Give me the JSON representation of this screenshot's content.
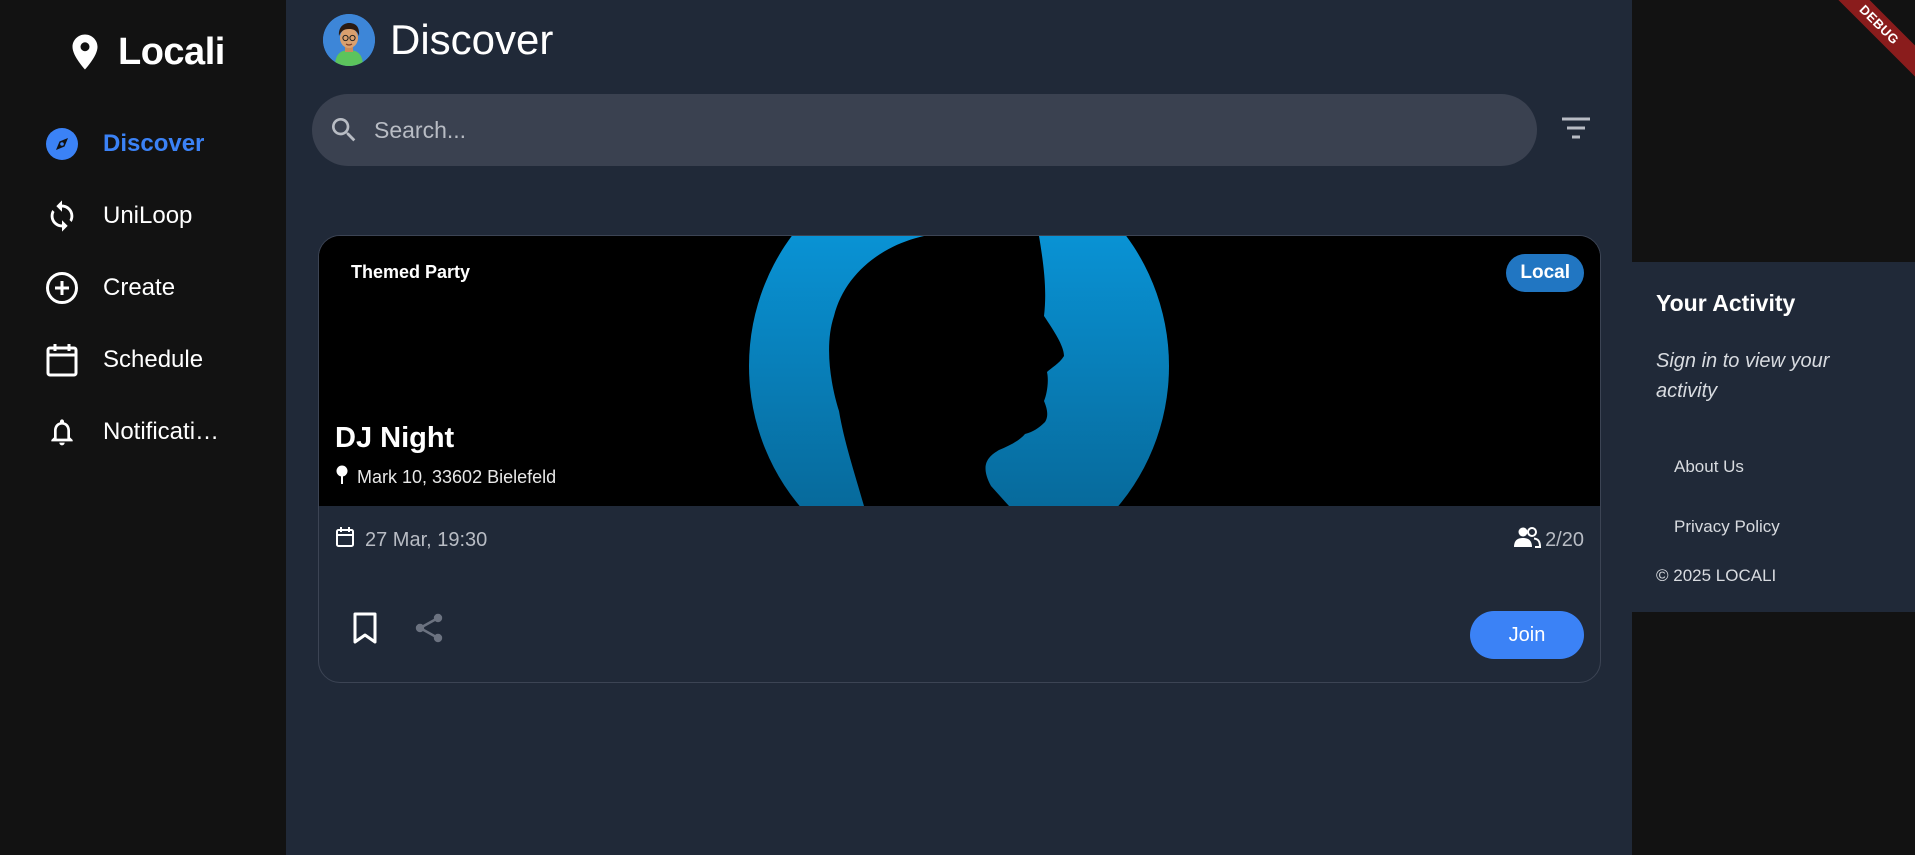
{
  "app": {
    "title": "Locali"
  },
  "sidebar": {
    "items": [
      {
        "label": "Discover",
        "icon": "compass-icon",
        "active": true
      },
      {
        "label": "UniLoop",
        "icon": "sync-icon",
        "active": false
      },
      {
        "label": "Create",
        "icon": "add-circle-icon",
        "active": false
      },
      {
        "label": "Schedule",
        "icon": "calendar-icon",
        "active": false
      },
      {
        "label": "Notifications",
        "display": "Notificati…",
        "icon": "bell-icon",
        "active": false
      }
    ]
  },
  "header": {
    "title": "Discover"
  },
  "search": {
    "placeholder": "Search..."
  },
  "event": {
    "category": "Themed Party",
    "badge": "Local",
    "title": "DJ Night",
    "location": "Mark 10, 33602 Bielefeld",
    "date": "27 Mar, 19:30",
    "participants": "2/20",
    "join_label": "Join"
  },
  "activity": {
    "title": "Your Activity",
    "message": "Sign in to view your activity",
    "about_label": "About Us",
    "privacy_label": "Privacy Policy",
    "copyright": "© 2025 LOCALI"
  },
  "debug_banner": "DEBUG",
  "colors": {
    "accent": "#3b82f6",
    "sidebar_bg": "#121212",
    "main_bg": "#202938",
    "badge_bg": "#2176c2",
    "image_glow": "#0a9fe6"
  }
}
